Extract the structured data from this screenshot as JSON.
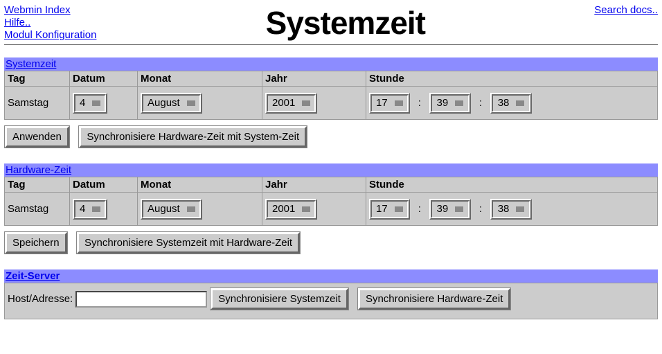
{
  "header": {
    "links": {
      "webmin_index": "Webmin Index",
      "help": "Hilfe..",
      "module_config": "Modul Konfiguration",
      "search_docs": "Search docs.."
    },
    "title": "Systemzeit"
  },
  "system_time": {
    "section_label": "Systemzeit",
    "headers": {
      "day": "Tag",
      "date": "Datum",
      "month": "Monat",
      "year": "Jahr",
      "hour": "Stunde"
    },
    "day": "Samstag",
    "date": "4",
    "month": "August",
    "year": "2001",
    "hh": "17",
    "mm": "39",
    "ss": "38",
    "apply_label": "Anwenden",
    "sync_label": "Synchronisiere Hardware-Zeit mit System-Zeit"
  },
  "hardware_time": {
    "section_label": "Hardware-Zeit",
    "headers": {
      "day": "Tag",
      "date": "Datum",
      "month": "Monat",
      "year": "Jahr",
      "hour": "Stunde"
    },
    "day": "Samstag",
    "date": "4",
    "month": "August",
    "year": "2001",
    "hh": "17",
    "mm": "39",
    "ss": "38",
    "save_label": "Speichern",
    "sync_label": "Synchronisiere Systemzeit mit Hardware-Zeit"
  },
  "time_server": {
    "section_label": "Zeit-Server",
    "host_label": "Host/Adresse:",
    "host_value": "",
    "sync_sys_label": "Synchronisiere Systemzeit",
    "sync_hw_label": "Synchronisiere Hardware-Zeit"
  }
}
